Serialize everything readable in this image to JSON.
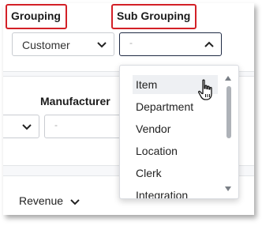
{
  "grouping": {
    "label": "Grouping",
    "value": "Customer"
  },
  "sub_grouping": {
    "label": "Sub Grouping",
    "placeholder": "-"
  },
  "filters": {
    "manufacturer_label": "Manufacturer",
    "manufacturer_placeholder": "-"
  },
  "footer": {
    "revenue_label": "Revenue"
  },
  "dropdown": {
    "options": [
      {
        "label": "Item",
        "hovered": true
      },
      {
        "label": "Department"
      },
      {
        "label": "Vendor"
      },
      {
        "label": "Location"
      },
      {
        "label": "Clerk"
      },
      {
        "label": "Integration"
      }
    ]
  },
  "colors": {
    "highlight": "#d32027",
    "focus_border": "#1f2a44"
  },
  "icons": [
    "chevron-down-icon",
    "chevron-up-icon",
    "hand-pointer-icon",
    "scroll-up-icon",
    "scroll-down-icon"
  ]
}
